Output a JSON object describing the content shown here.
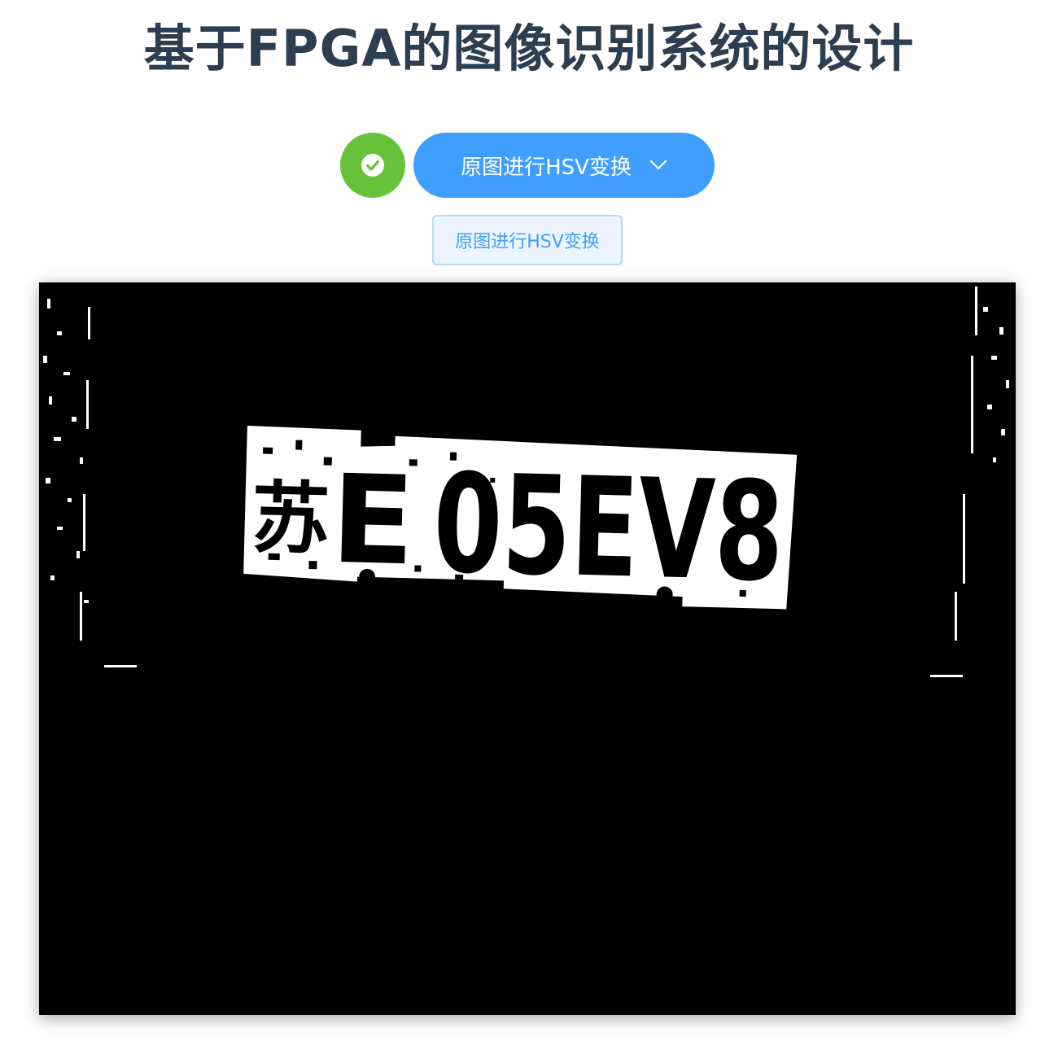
{
  "page": {
    "title": "基于FPGA的图像识别系统的设计"
  },
  "controls": {
    "status_icon": "check-circle-icon",
    "dropdown_label": "原图进行HSV变换",
    "dropdown_icon": "chevron-down-icon",
    "secondary_button_label": "原图进行HSV变换"
  },
  "result_image": {
    "plate_text": "苏E 05EV8",
    "plate_prefix": "苏",
    "plate_letter": "E",
    "plate_number": "05EV8"
  },
  "colors": {
    "title": "#2c3e50",
    "success": "#67c23a",
    "primary": "#409eff",
    "primary_light_bg": "#ecf5ff",
    "primary_light_border": "#b3d8ff"
  }
}
